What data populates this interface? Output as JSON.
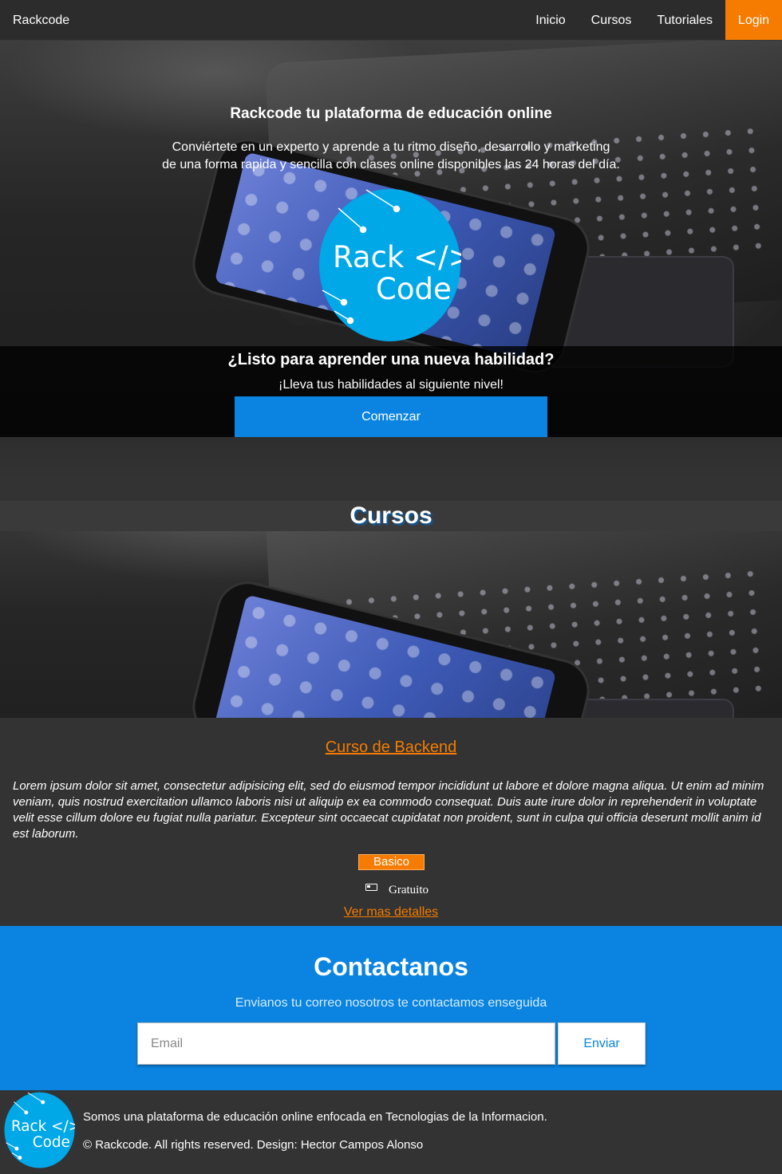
{
  "nav": {
    "brand": "Rackcode",
    "links": [
      "Inicio",
      "Cursos",
      "Tutoriales"
    ],
    "login": "Login"
  },
  "hero": {
    "title": "Rackcode tu plataforma de educación online",
    "desc_line1": "Conviértete en un experto y aprende a tu ritmo diseño, desarrollo y marketing",
    "desc_line2": "de una forma rapida y sencilla con clases online disponibles las 24 horas del día.",
    "logo_line1": "Rack </>",
    "logo_line2": "Code"
  },
  "cta": {
    "title": "¿Listo para aprender una nueva habilidad?",
    "subtitle": "¡Lleva tus habilidades al siguiente nivel!",
    "button": "Comenzar"
  },
  "cursos": {
    "title": "Cursos",
    "course": {
      "name": "Curso de Backend",
      "description": "Lorem ipsum dolor sit amet, consectetur adipisicing elit, sed do eiusmod tempor incididunt ut labore et dolore magna aliqua. Ut enim ad minim veniam, quis nostrud exercitation ullamco laboris nisi ut aliquip ex ea commodo consequat. Duis aute irure dolor in reprehenderit in voluptate velit esse cillum dolore eu fugiat nulla pariatur. Excepteur sint occaecat cupidatat non proident, sunt in culpa qui officia deserunt mollit anim id est laborum.",
      "level": "Basico",
      "price": "Gratuito",
      "details_link": "Ver mas detalles"
    }
  },
  "contact": {
    "title": "Contactanos",
    "subtitle": "Envianos tu correo nosotros te contactamos enseguida",
    "email_placeholder": "Email",
    "send": "Enviar"
  },
  "footer": {
    "about": "Somos una plataforma de educación online enfocada en Tecnologias de la Informacion.",
    "copyright": "© Rackcode. All rights reserved. Design: Hector Campos Alonso",
    "logo_line1": "Rack </>",
    "logo_line2": "Code"
  },
  "colors": {
    "accent_orange": "#f57c00",
    "primary_blue": "#0a84e0",
    "logo_blue": "#00a8e8",
    "background": "#333333"
  }
}
